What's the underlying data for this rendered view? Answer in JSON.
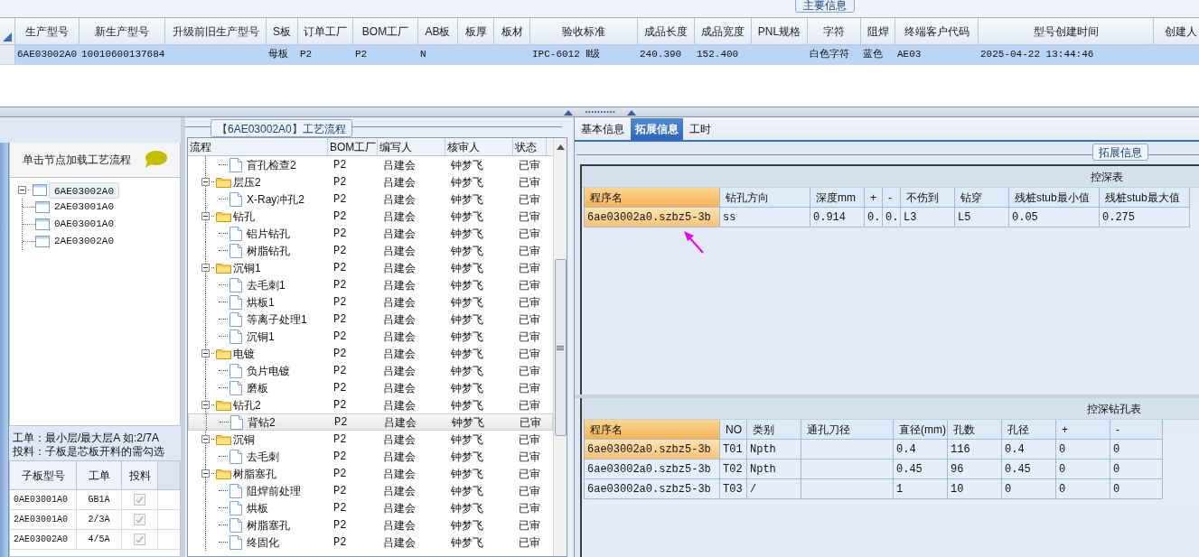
{
  "main_info": {
    "title": "主要信息",
    "columns": [
      {
        "header": "生产型号",
        "value": "6AE03002A0"
      },
      {
        "header": "新生产型号",
        "value": "10010600137684"
      },
      {
        "header": "升级前旧生产型号"
      },
      {
        "header": "S板",
        "value": "母板"
      },
      {
        "header": "订单工厂",
        "value": "P2"
      },
      {
        "header": "BOM工厂",
        "value": "P2"
      },
      {
        "header": "AB板",
        "value": "N"
      },
      {
        "header": "板厚"
      },
      {
        "header": "板材"
      },
      {
        "header": "验收标准",
        "value": "IPC-6012 Ⅱ级"
      },
      {
        "header": "成品长度",
        "value": "240.390"
      },
      {
        "header": "成品宽度",
        "value": "152.400"
      },
      {
        "header": "PNL规格"
      },
      {
        "header": "字符",
        "value": "白色字符"
      },
      {
        "header": "阻焊",
        "value": "蓝色"
      },
      {
        "header": "终端客户代码",
        "value": "AE03"
      },
      {
        "header": "型号创建时间",
        "value": "2025-04-22 13:44:46"
      },
      {
        "header": "创建人"
      }
    ],
    "row": {
      "selected": true
    }
  },
  "left_panel": {
    "header": "单击节点加载工艺流程",
    "tree": [
      {
        "label": "6AE03002A0",
        "expanded": true,
        "selected": true,
        "children": [
          {
            "label": "2AE03001A0",
            "selected": false
          },
          {
            "label": "0AE03001A0",
            "selected": false
          },
          {
            "label": "2AE03002A0",
            "selected": false
          }
        ]
      }
    ],
    "note": [
      "工单：最小层/最大层A 如:2/7A",
      "投料：子板是芯板开料的需勾选"
    ],
    "grid": {
      "columns": [
        "子板型号",
        "工单",
        "投料"
      ],
      "rows": [
        {
          "model": "0AE03001A0",
          "order": "GB1A",
          "checked": true,
          "disabled": true
        },
        {
          "model": "2AE03001A0",
          "order": "2/3A",
          "checked": true,
          "disabled": true
        },
        {
          "model": "2AE03002A0",
          "order": "4/5A",
          "checked": true,
          "disabled": true
        }
      ]
    }
  },
  "process_flow": {
    "title": "【6AE03002A0】工艺流程",
    "columns": [
      "流程",
      "BOM工厂",
      "编写人",
      "核审人",
      "状态"
    ],
    "tree": [
      {
        "children": [
          {
            "label": "盲孔检查2",
            "bom": "P2",
            "author": "吕建会",
            "reviewer": "钟梦飞",
            "status": "已审",
            "selected": false
          }
        ]
      },
      {
        "label": "层压2",
        "expanded": true,
        "bom": "P2",
        "author": "吕建会",
        "reviewer": "钟梦飞",
        "status": "已审",
        "selected": false,
        "children": [
          {
            "label": "X-Ray冲孔2",
            "bom": "P2",
            "author": "吕建会",
            "reviewer": "钟梦飞",
            "status": "已审",
            "selected": false
          }
        ]
      },
      {
        "label": "钻孔",
        "expanded": true,
        "bom": "P2",
        "author": "吕建会",
        "reviewer": "钟梦飞",
        "status": "已审",
        "selected": false,
        "children": [
          {
            "label": "铝片钻孔",
            "bom": "P2",
            "author": "吕建会",
            "reviewer": "钟梦飞",
            "status": "已审",
            "selected": false
          },
          {
            "label": "树脂钻孔",
            "bom": "P2",
            "author": "吕建会",
            "reviewer": "钟梦飞",
            "status": "已审",
            "selected": false
          }
        ]
      },
      {
        "label": "沉铜1",
        "expanded": true,
        "bom": "P2",
        "author": "吕建会",
        "reviewer": "钟梦飞",
        "status": "已审",
        "selected": false,
        "children": [
          {
            "label": "去毛刺1",
            "bom": "P2",
            "author": "吕建会",
            "reviewer": "钟梦飞",
            "status": "已审",
            "selected": false
          },
          {
            "label": "烘板1",
            "bom": "P2",
            "author": "吕建会",
            "reviewer": "钟梦飞",
            "status": "已审",
            "selected": false
          },
          {
            "label": "等离子处理1",
            "bom": "P2",
            "author": "吕建会",
            "reviewer": "钟梦飞",
            "status": "已审",
            "selected": false
          },
          {
            "label": "沉铜1",
            "bom": "P2",
            "author": "吕建会",
            "reviewer": "钟梦飞",
            "status": "已审",
            "selected": false
          }
        ]
      },
      {
        "label": "电镀",
        "expanded": true,
        "bom": "P2",
        "author": "吕建会",
        "reviewer": "钟梦飞",
        "status": "已审",
        "selected": false,
        "children": [
          {
            "label": "负片电镀",
            "bom": "P2",
            "author": "吕建会",
            "reviewer": "钟梦飞",
            "status": "已审",
            "selected": false
          },
          {
            "label": "磨板",
            "bom": "P2",
            "author": "吕建会",
            "reviewer": "钟梦飞",
            "status": "已审",
            "selected": false
          }
        ]
      },
      {
        "label": "钻孔2",
        "expanded": true,
        "bom": "P2",
        "author": "吕建会",
        "reviewer": "钟梦飞",
        "status": "已审",
        "selected": false,
        "children": [
          {
            "label": "背钻2",
            "bom": "P2",
            "author": "吕建会",
            "reviewer": "钟梦飞",
            "status": "已审",
            "selected": true
          }
        ]
      },
      {
        "label": "沉铜",
        "expanded": true,
        "bom": "P2",
        "author": "吕建会",
        "reviewer": "钟梦飞",
        "status": "已审",
        "selected": false,
        "children": [
          {
            "label": "去毛刺",
            "bom": "P2",
            "author": "吕建会",
            "reviewer": "钟梦飞",
            "status": "已审",
            "selected": false
          }
        ]
      },
      {
        "label": "树脂塞孔",
        "expanded": true,
        "bom": "P2",
        "author": "吕建会",
        "reviewer": "钟梦飞",
        "status": "已审",
        "selected": false,
        "children": [
          {
            "label": "阻焊前处理",
            "bom": "P2",
            "author": "吕建会",
            "reviewer": "钟梦飞",
            "status": "已审",
            "selected": false
          },
          {
            "label": "烘板",
            "bom": "P2",
            "author": "吕建会",
            "reviewer": "钟梦飞",
            "status": "已审",
            "selected": false
          },
          {
            "label": "树脂塞孔",
            "bom": "P2",
            "author": "吕建会",
            "reviewer": "钟梦飞",
            "status": "已审",
            "selected": false
          },
          {
            "label": "终固化",
            "bom": "P2",
            "author": "吕建会",
            "reviewer": "钟梦飞",
            "status": "已审",
            "selected": false
          }
        ]
      }
    ]
  },
  "detail": {
    "tabs": [
      {
        "label": "基本信息",
        "selected": false
      },
      {
        "label": "拓展信息",
        "selected": true
      },
      {
        "label": "工时",
        "selected": false
      }
    ],
    "group_title": "拓展信息",
    "depth_table": {
      "title": "控深表",
      "columns": [
        "程序名",
        "钻孔方向",
        "深度mm",
        "+",
        "-",
        "不伤到",
        "钻穿",
        "残桩stub最小值",
        "残桩stub最大值"
      ],
      "rows": [
        {
          "selected": true,
          "program": "6ae03002a0.szbz5-3b",
          "direction": "ss",
          "depth": "0.914",
          "plus": "0.",
          "minus": "0.",
          "avoid": "L3",
          "through": "L5",
          "stub_min": "0.05",
          "stub_max": "0.275"
        }
      ]
    },
    "drill_table": {
      "title": "控深钻孔表",
      "columns": [
        "程序名",
        "NO",
        "类别",
        "通孔刀径",
        "直径(mm)",
        "孔数",
        "孔径",
        "+",
        "-"
      ],
      "rows": [
        {
          "selected": true,
          "program": "6ae03002a0.szbz5-3b",
          "no": "T01",
          "type": "Npth",
          "diameter": "0.4",
          "count": "116",
          "hole": "0.4",
          "plus": "0",
          "minus": "0"
        },
        {
          "selected": false,
          "program": "6ae03002a0.szbz5-3b",
          "no": "T02",
          "type": "Npth",
          "diameter": "0.45",
          "count": "96",
          "hole": "0.45",
          "plus": "0",
          "minus": "0"
        },
        {
          "selected": false,
          "program": "6ae03002a0.szbz5-3b",
          "no": "T03",
          "type": "/",
          "diameter": "1",
          "count": "10",
          "hole": "0",
          "plus": "0",
          "minus": "0"
        }
      ]
    }
  }
}
